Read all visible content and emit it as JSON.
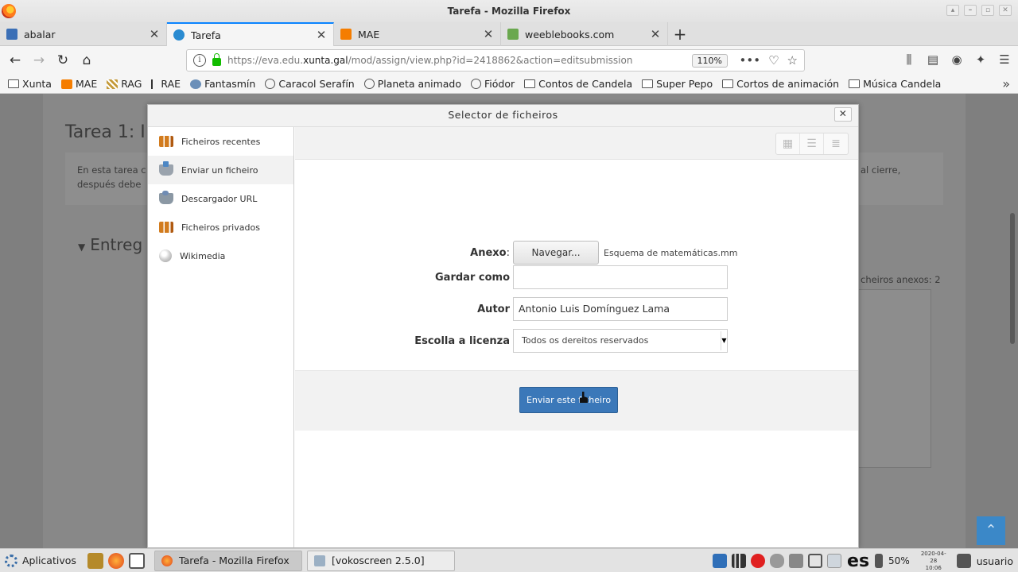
{
  "window": {
    "title": "Tarefa - Mozilla Firefox"
  },
  "tabs": [
    {
      "label": "abalar",
      "favicon_color": "#3b6fb6"
    },
    {
      "label": "Tarefa",
      "favicon_color": "#2a8bd1",
      "active": true
    },
    {
      "label": "MAE",
      "favicon_color": "#f57d00"
    },
    {
      "label": "weeblebooks.com",
      "favicon_color": "#6aa84f"
    }
  ],
  "nav": {
    "url_prefix": "https://eva.edu.",
    "url_domain": "xunta.gal",
    "url_rest": "/mod/assign/view.php?id=2418862&action=editsubmission",
    "zoom": "110%"
  },
  "bookmarks": [
    {
      "label": "Xunta",
      "icon": "folder-icon"
    },
    {
      "label": "MAE",
      "icon": "blogger-icon"
    },
    {
      "label": "RAG",
      "icon": "rag-icon"
    },
    {
      "label": "RAE",
      "icon": "rae-icon"
    },
    {
      "label": "Fantasmín",
      "icon": "fantasmin-icon"
    },
    {
      "label": "Caracol Serafín",
      "icon": "globe-icon"
    },
    {
      "label": "Planeta animado",
      "icon": "globe-icon"
    },
    {
      "label": "Fiódor",
      "icon": "globe-icon"
    },
    {
      "label": "Contos de Candela",
      "icon": "folder-icon"
    },
    {
      "label": "Super Pepo",
      "icon": "folder-icon"
    },
    {
      "label": "Cortos de animación",
      "icon": "folder-icon"
    },
    {
      "label": "Música Candela",
      "icon": "folder-icon"
    }
  ],
  "background_page": {
    "title": "Tarea 1: I",
    "intro_line1_left": "En esta tarea c",
    "intro_line1_right": "al cierre,",
    "intro_line2_left": "después debe",
    "section": "Entreg",
    "attachments_hint": "cheiros anexos: 2"
  },
  "modal": {
    "title": "Selector de ficheiros",
    "sidebar": [
      {
        "label": "Ficheiros recentes",
        "icon": "recent"
      },
      {
        "label": "Enviar un ficheiro",
        "icon": "upload",
        "active": true
      },
      {
        "label": "Descargador URL",
        "icon": "url"
      },
      {
        "label": "Ficheiros privados",
        "icon": "recent"
      },
      {
        "label": "Wikimedia",
        "icon": "wiki"
      }
    ],
    "form": {
      "attachment_label": "Anexo",
      "browse_label": "Navegar...",
      "selected_file": "Esquema de matemáticas.mm",
      "saveas_label": "Gardar como",
      "saveas_value": "",
      "author_label": "Autor",
      "author_value": "Antonio Luis Domínguez Lama",
      "license_label": "Escolla a licenza",
      "license_value": "Todos os dereitos reservados",
      "submit_label": "Enviar este ficheiro"
    }
  },
  "taskbar": {
    "apps_label": "Aplicativos",
    "tasks": [
      {
        "label": "Tarefa - Mozilla Firefox",
        "active": true
      },
      {
        "label": "[vokoscreen 2.5.0]",
        "active": false
      }
    ],
    "language": "es",
    "battery": "50%",
    "date": "2020-04-28",
    "time": "10:06",
    "user": "usuario"
  }
}
